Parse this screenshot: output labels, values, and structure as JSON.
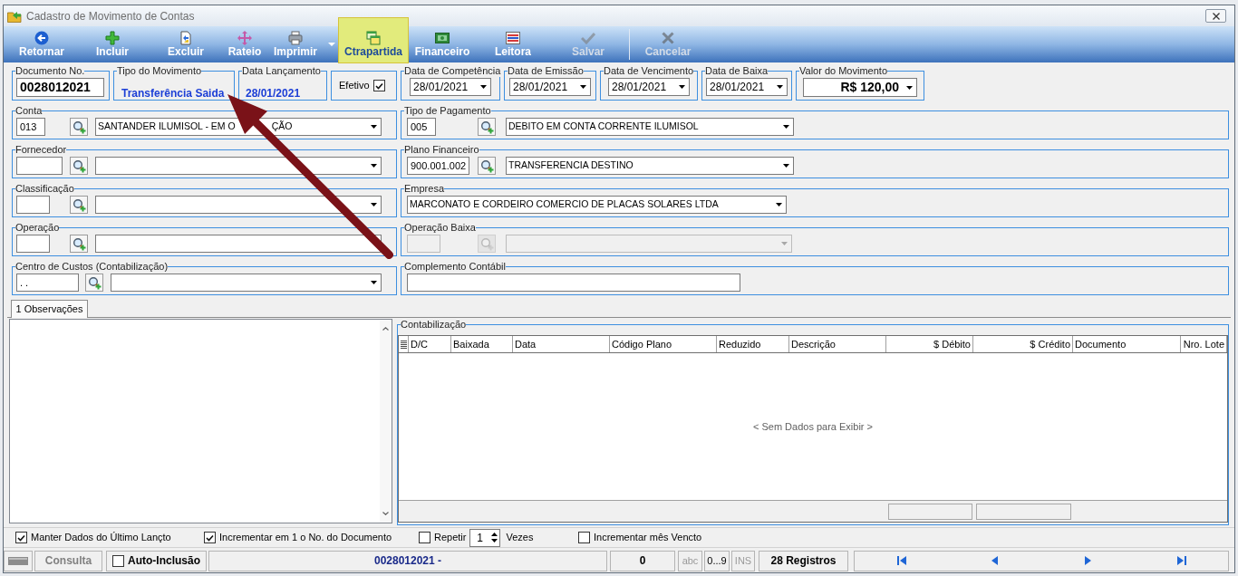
{
  "window": {
    "title": "Cadastro de Movimento de Contas"
  },
  "toolbar": [
    {
      "label": "Retornar",
      "disabled": false,
      "highlighted": false
    },
    {
      "label": "Incluir",
      "disabled": false,
      "highlighted": false
    },
    {
      "label": "Excluir",
      "disabled": false,
      "highlighted": false
    },
    {
      "label": "Rateio",
      "disabled": false,
      "highlighted": false
    },
    {
      "label": "Imprimir",
      "disabled": false,
      "highlighted": false,
      "dropdown": true
    },
    {
      "label": "Ctrapartida",
      "disabled": false,
      "highlighted": true
    },
    {
      "label": "Financeiro",
      "disabled": false,
      "highlighted": false
    },
    {
      "label": "Leitora",
      "disabled": false,
      "highlighted": false
    },
    {
      "label": "Salvar",
      "disabled": true,
      "highlighted": false
    },
    {
      "label": "Cancelar",
      "disabled": true,
      "highlighted": false
    }
  ],
  "header": {
    "document": {
      "label": "Documento No.",
      "value": "0028012021"
    },
    "movement_type": {
      "label": "Tipo do Movimento",
      "value": "Transferência Saida"
    },
    "entry_date": {
      "label": "Data Lançamento",
      "value": "28/01/2021"
    },
    "effective": {
      "label": "Efetivo",
      "checked": true
    },
    "dates": [
      {
        "label": "Data de Competência",
        "value": "28/01/2021"
      },
      {
        "label": "Data de Emissão",
        "value": "28/01/2021"
      },
      {
        "label": "Data de Vencimento",
        "value": "28/01/2021"
      },
      {
        "label": "Data de Baixa",
        "value": "28/01/2021"
      }
    ],
    "amount": {
      "label": "Valor do Movimento",
      "value": "R$ 120,00"
    }
  },
  "left_groups": [
    {
      "kind": "lookup",
      "label": "Conta",
      "code": "013",
      "value_parts": [
        "SANTANDER ILUMISOL - EM O",
        "ÇÃO"
      ],
      "dropdown": true,
      "disabled": false
    },
    {
      "kind": "lookup",
      "label": "Fornecedor",
      "dropdown": true,
      "disabled": false
    },
    {
      "kind": "lookup",
      "label": "Classificação",
      "dropdown": true,
      "disabled": false
    },
    {
      "kind": "lookup",
      "label": "Operação",
      "disabled": false
    },
    {
      "kind": "lookup",
      "label": "Centro de Custos (Contabilização)",
      "code": ". .",
      "dropdown": true,
      "disabled": false
    }
  ],
  "right_groups": [
    {
      "kind": "lookup",
      "label": "Tipo de Pagamento",
      "code": "005",
      "value": "DEBITO EM CONTA CORRENTE ILUMISOL",
      "dropdown": true,
      "disabled": false
    },
    {
      "kind": "lookup",
      "label": "Plano Financeiro",
      "code": "900.001.002",
      "value": "TRANSFERENCIA DESTINO",
      "dropdown": true,
      "disabled": false
    },
    {
      "kind": "combo",
      "label": "Empresa",
      "value": "MARCONATO E CORDEIRO COMERCIO DE PLACAS SOLARES LTDA",
      "dropdown": true,
      "disabled": false
    },
    {
      "kind": "lookup",
      "label": "Operação Baixa",
      "dropdown": true,
      "disabled": true
    },
    {
      "kind": "text",
      "label": "Complemento Contábil",
      "disabled": false
    }
  ],
  "tabs": [
    {
      "label": "1 Observações",
      "selected": true
    }
  ],
  "accounting": {
    "title": "Contabilização",
    "columns": [
      "D/C",
      "Baixada",
      "Data",
      "Código Plano",
      "Reduzido",
      "Descrição",
      "$ Débito",
      "$ Crédito",
      "Documento",
      "Nro. Lote"
    ],
    "empty_message": "< Sem Dados para Exibir >"
  },
  "options": [
    {
      "kind": "checkbox",
      "label": "Manter Dados do Último Lançto",
      "checked": true
    },
    {
      "kind": "checkbox",
      "label": "Incrementar em 1 o No. do Documento",
      "checked": true
    },
    {
      "kind": "repeat",
      "label": "Repetir",
      "checked": false,
      "count": "1",
      "suffix": "Vezes"
    },
    {
      "kind": "checkbox",
      "label": "Incrementar mês Vencto",
      "checked": false
    }
  ],
  "status_bar": {
    "mode": "Consulta",
    "auto_inclusion": {
      "label": "Auto-Inclusão",
      "checked": false
    },
    "record": "0028012021 -",
    "counter": "0",
    "indicators": [
      {
        "label": "abc",
        "on": false
      },
      {
        "label": "0...9",
        "on": true
      },
      {
        "label": "INS",
        "on": false
      }
    ],
    "records": "28 Registros"
  }
}
